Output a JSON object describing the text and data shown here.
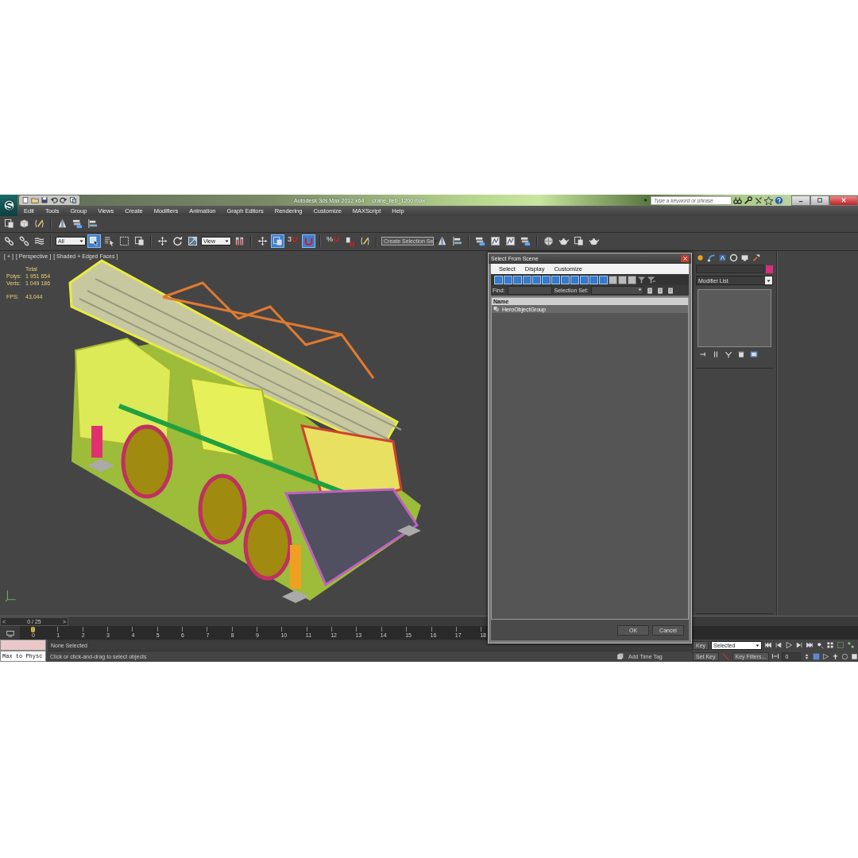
{
  "window": {
    "title": "Autodesk 3ds Max 2012 x64",
    "document": "crane_lieb_1200.max",
    "search": {
      "placeholder": "Type a keyword or phrase"
    }
  },
  "menu": [
    "Edit",
    "Tools",
    "Group",
    "Views",
    "Create",
    "Modifiers",
    "Animation",
    "Graph Editors",
    "Rendering",
    "Customize",
    "MAXScript",
    "Help"
  ],
  "main_toolbar": [
    {
      "kind": "icon",
      "active": false
    },
    {
      "kind": "icon",
      "active": false
    },
    {
      "kind": "icon",
      "active": false
    },
    {
      "kind": "dropdown",
      "value": "All"
    },
    {
      "kind": "icon",
      "active": true
    },
    {
      "kind": "icon",
      "active": false
    },
    {
      "kind": "icon",
      "active": false
    },
    {
      "kind": "icon",
      "active": false
    },
    {
      "kind": "icon",
      "active": false
    },
    {
      "kind": "icon",
      "active": false
    },
    {
      "kind": "icon",
      "active": false
    },
    {
      "kind": "dropdown",
      "value": "View"
    },
    {
      "kind": "icon",
      "active": false
    },
    {
      "kind": "icon",
      "active": false
    },
    {
      "kind": "icon",
      "active": true
    },
    {
      "kind": "snap",
      "label": "3",
      "active": false
    },
    {
      "kind": "icon",
      "active": true
    },
    {
      "kind": "snap",
      "label": "%",
      "active": false
    },
    {
      "kind": "icon",
      "active": false
    },
    {
      "kind": "icon",
      "active": false
    },
    {
      "kind": "dropdown",
      "value": "Create Selection Se"
    },
    {
      "kind": "icon",
      "active": false
    },
    {
      "kind": "icon",
      "active": false
    },
    {
      "kind": "icon",
      "active": false
    },
    {
      "kind": "icon",
      "active": false
    },
    {
      "kind": "icon",
      "active": false
    },
    {
      "kind": "icon",
      "active": false
    },
    {
      "kind": "icon",
      "active": false
    },
    {
      "kind": "icon",
      "active": false
    },
    {
      "kind": "icon",
      "active": false
    },
    {
      "kind": "icon",
      "active": false
    }
  ],
  "viewport": {
    "labels": [
      "[ + ]",
      "[ Perspective ]",
      "[ Shaded + Edged Faces ]"
    ],
    "stats": {
      "header": "Total",
      "rows": [
        {
          "label": "Polys:",
          "value": "1 951 654"
        },
        {
          "label": "Verts:",
          "value": "1 049 186"
        },
        {
          "label": "FPS:",
          "value": "43,044"
        }
      ]
    }
  },
  "command_panel": {
    "modifier_list": "Modifier List"
  },
  "dialog": {
    "title": "Select From Scene",
    "menu": [
      "Select",
      "Display",
      "Customize"
    ],
    "filters": [
      {
        "active": true
      },
      {
        "active": true
      },
      {
        "active": true
      },
      {
        "active": true
      },
      {
        "active": true
      },
      {
        "active": true
      },
      {
        "active": true
      },
      {
        "active": true
      },
      {
        "active": true
      },
      {
        "active": true
      },
      {
        "active": true
      },
      {
        "active": true
      },
      {
        "active": false
      },
      {
        "active": false
      },
      {
        "active": false
      }
    ],
    "find_label": "Find:",
    "selection_set_label": "Selection Set:",
    "columns": [
      "Name"
    ],
    "rows": [
      {
        "name": "HeroObjectGroup",
        "selected": true
      }
    ],
    "buttons": [
      "OK",
      "Cancel"
    ]
  },
  "time_slider": {
    "prev": "<",
    "position": "0 / 25",
    "next": ">"
  },
  "track_bar": {
    "ticks": [
      "0",
      "1",
      "2",
      "3",
      "4",
      "5",
      "6",
      "7",
      "8",
      "9",
      "10",
      "11",
      "12",
      "13",
      "14",
      "15",
      "16",
      "17",
      "18"
    ]
  },
  "status": {
    "script_box": "Max to Physc",
    "selection": "None Selected",
    "prompt": "Click or click-and-drag to select objects",
    "time_tag": "Add Time Tag",
    "auto_key": "Key",
    "key_mode": "Selected",
    "set_key": "Set Key",
    "key_filters": "Key Filters...",
    "frame": "0"
  }
}
